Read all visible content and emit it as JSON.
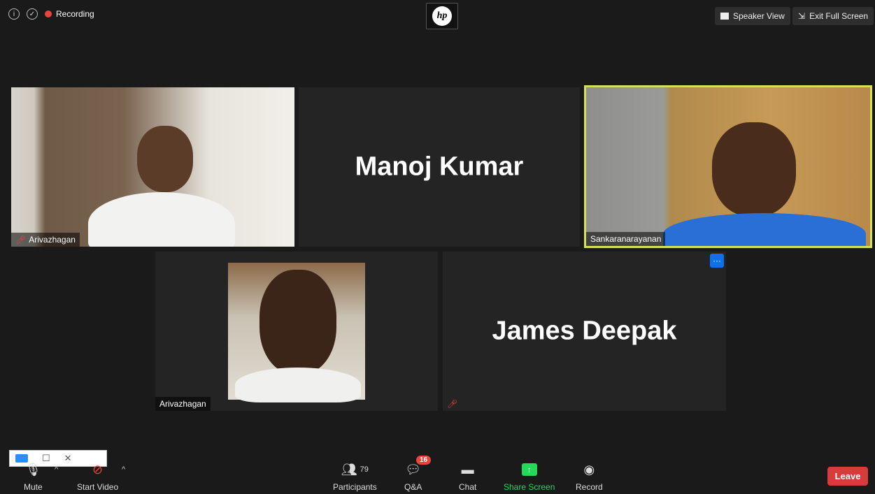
{
  "top_bar": {
    "recording_label": "Recording",
    "info_icon": "info-icon",
    "security_icon": "shield-icon",
    "logo_text": "hp",
    "speaker_view_label": "Speaker View",
    "exit_fullscreen_label": "Exit Full Screen"
  },
  "tiles": {
    "top_left_name": "Arivazhagan",
    "top_center_name": "Manoj Kumar",
    "top_right_name": "Sankaranarayanan",
    "bottom_left_name": "Arivazhagan",
    "bottom_right_name": "James Deepak",
    "more_button_glyph": "···"
  },
  "toolbar": {
    "mute_label": "Mute",
    "start_video_label": "Start Video",
    "participants_label": "Participants",
    "participants_count": "79",
    "qa_label": "Q&A",
    "qa_badge": "16",
    "chat_label": "Chat",
    "share_screen_label": "Share Screen",
    "record_label": "Record",
    "leave_label": "Leave"
  },
  "colors": {
    "background": "#1a1a1a",
    "tile": "#242424",
    "active_speaker_border": "#d4e157",
    "share_green": "#23d959",
    "leave_red": "#d83b3b",
    "accent_blue": "#0e71eb"
  }
}
